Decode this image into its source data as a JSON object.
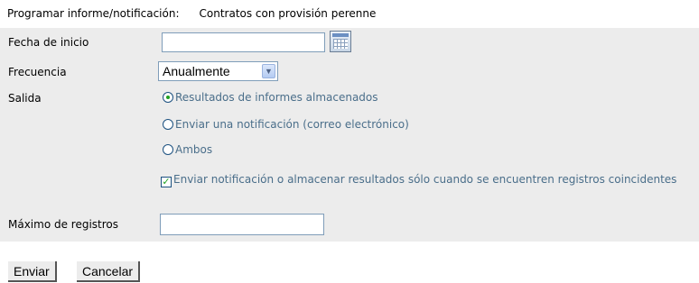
{
  "header": {
    "label": "Programar informe/notificación:",
    "value": "Contratos con provisión perenne"
  },
  "form": {
    "start_date": {
      "label": "Fecha de inicio",
      "value": "",
      "calendar_icon": "calendar-icon"
    },
    "frequency": {
      "label": "Frecuencia",
      "selected": "Anualmente"
    },
    "output": {
      "label": "Salida",
      "options": [
        {
          "label": "Resultados de informes almacenados",
          "selected": true
        },
        {
          "label": "Enviar una notificación (correo electrónico)",
          "selected": false
        },
        {
          "label": "Ambos",
          "selected": false
        }
      ],
      "checkbox": {
        "label": "Enviar notificación o almacenar resultados sólo cuando se encuentren registros coincidentes",
        "checked": true
      }
    },
    "max_records": {
      "label": "Máximo de registros",
      "value": ""
    }
  },
  "buttons": {
    "submit": "Enviar",
    "cancel": "Cancelar"
  },
  "colors": {
    "panel": "#ececec",
    "option_text": "#4a6e8a",
    "radio_dot": "#21a121"
  }
}
